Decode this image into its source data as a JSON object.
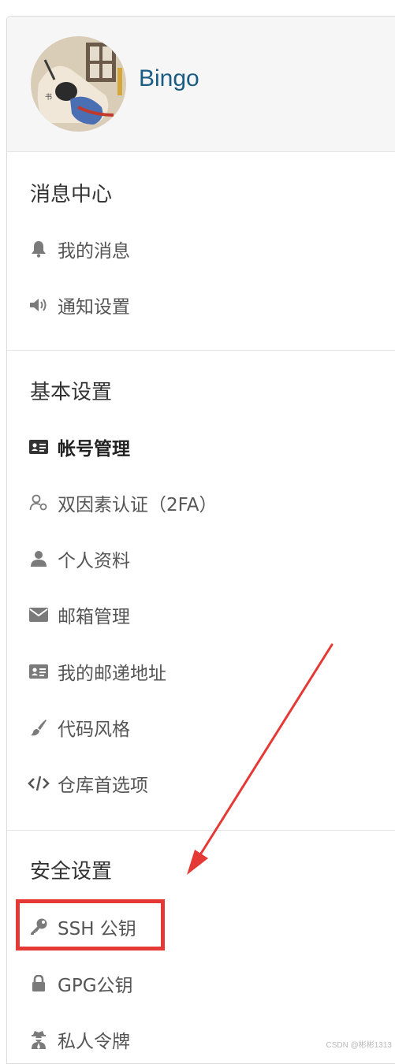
{
  "profile": {
    "username": "Bingo"
  },
  "sections": {
    "messages": {
      "title": "消息中心",
      "items": {
        "my_messages": "我的消息",
        "notification_settings": "通知设置"
      }
    },
    "basic": {
      "title": "基本设置",
      "items": {
        "account": "帐号管理",
        "two_factor": "双因素认证（2FA）",
        "profile": "个人资料",
        "email": "邮箱管理",
        "address": "我的邮递地址",
        "code_style": "代码风格",
        "repo_prefs": "仓库首选项"
      }
    },
    "security": {
      "title": "安全设置",
      "items": {
        "ssh_keys": "SSH 公钥",
        "gpg_keys": "GPG公钥",
        "tokens": "私人令牌"
      }
    }
  },
  "active_item": "帐号管理",
  "annotation_color": "#e53935",
  "watermark": "CSDN @彬彬1313",
  "icons": {
    "my_messages": "bell-icon",
    "notification_settings": "speaker-icon",
    "account": "id-card-icon",
    "two_factor": "user-key-icon",
    "profile": "user-icon",
    "email": "envelope-icon",
    "address": "address-card-icon",
    "code_style": "paint-brush-icon",
    "repo_prefs": "code-icon",
    "ssh_keys": "key-icon",
    "gpg_keys": "lock-icon",
    "tokens": "user-secret-icon"
  }
}
